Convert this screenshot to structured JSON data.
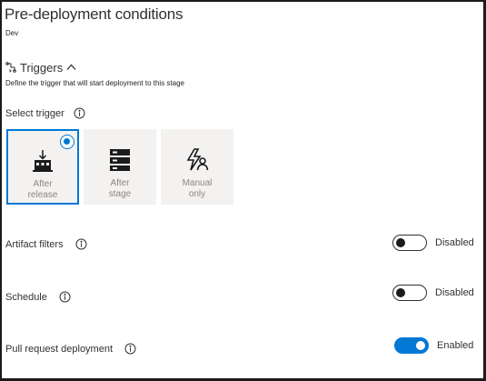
{
  "panel": {
    "title": "Pre-deployment conditions",
    "stage": "Dev"
  },
  "triggers": {
    "heading": "Triggers",
    "description": "Define the trigger that will start deployment to this stage",
    "select_label": "Select trigger",
    "options": [
      {
        "line1": "After",
        "line2": "release",
        "icon": "release-icon",
        "selected": true
      },
      {
        "line1": "After",
        "line2": "stage",
        "icon": "stage-icon",
        "selected": false
      },
      {
        "line1": "Manual",
        "line2": "only",
        "icon": "manual-icon",
        "selected": false
      }
    ]
  },
  "settings": [
    {
      "label": "Artifact filters",
      "state": "Disabled",
      "on": false
    },
    {
      "label": "Schedule",
      "state": "Disabled",
      "on": false
    },
    {
      "label": "Pull request deployment",
      "state": "Enabled",
      "on": true
    }
  ],
  "colors": {
    "accent": "#0078d4",
    "tile_bg": "#f3f2f1",
    "muted_text": "#8a8886"
  }
}
